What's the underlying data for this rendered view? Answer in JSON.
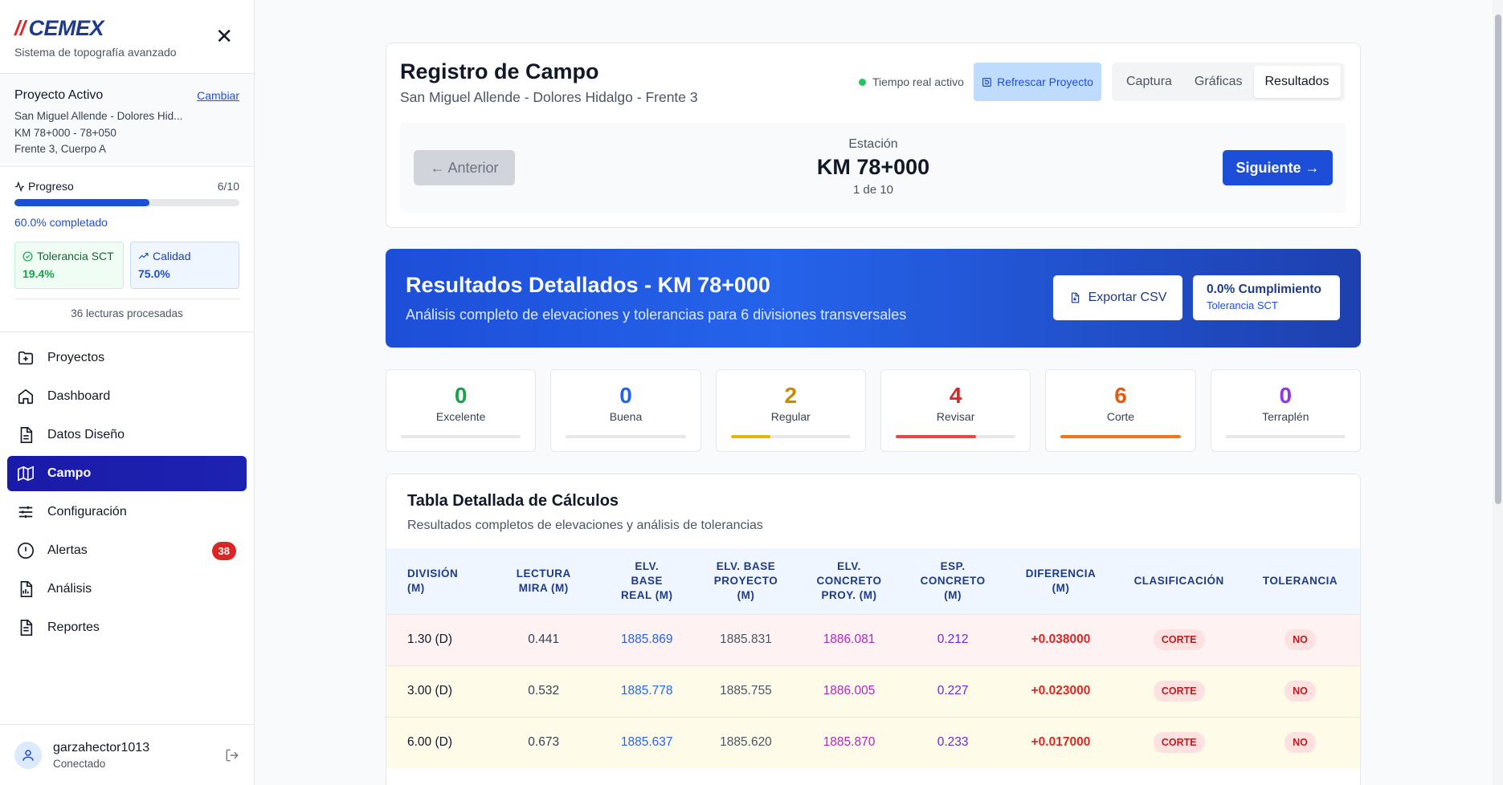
{
  "brand": {
    "logo_text": "CEMEX",
    "subtitle": "Sistema de topografía avanzado"
  },
  "project": {
    "label": "Proyecto Activo",
    "change_label": "Cambiar",
    "name": "San Miguel Allende - Dolores Hid...",
    "range": "KM 78+000 - 78+050",
    "section": "Frente 3, Cuerpo A"
  },
  "progress": {
    "label": "Progreso",
    "count": "6/10",
    "fraction": 0.6,
    "completed_text": "60.0% completado",
    "tolerance_label": "Tolerancia SCT",
    "tolerance_value": "19.4%",
    "quality_label": "Calidad",
    "quality_value": "75.0%",
    "readings_text": "36 lecturas procesadas"
  },
  "nav": {
    "items": [
      {
        "label": "Proyectos",
        "icon": "folder-plus-icon"
      },
      {
        "label": "Dashboard",
        "icon": "home-icon"
      },
      {
        "label": "Datos Diseño",
        "icon": "document-icon"
      },
      {
        "label": "Campo",
        "icon": "map-icon",
        "active": true
      },
      {
        "label": "Configuración",
        "icon": "sliders-icon"
      },
      {
        "label": "Alertas",
        "icon": "alert-circle-icon",
        "badge": "38"
      },
      {
        "label": "Análisis",
        "icon": "file-chart-icon"
      },
      {
        "label": "Reportes",
        "icon": "file-text-icon"
      }
    ]
  },
  "user": {
    "name": "garzahector1013",
    "status": "Conectado"
  },
  "header": {
    "title": "Registro de Campo",
    "subtitle": "San Miguel Allende - Dolores Hidalgo - Frente 3",
    "live_text": "Tiempo real activo",
    "refresh_label": "Refrescar Proyecto",
    "tabs": [
      "Captura",
      "Gráficas",
      "Resultados"
    ],
    "active_tab": "Resultados"
  },
  "station": {
    "prev_label": "← Anterior",
    "next_label": "Siguiente →",
    "label": "Estación",
    "km": "KM 78+000",
    "count": "1 de 10"
  },
  "banner": {
    "title": "Resultados Detallados - KM 78+000",
    "description": "Análisis completo de elevaciones y tolerancias para 6 divisiones transversales",
    "export_label": "Exportar CSV",
    "compliance_value": "0.0% Cumplimiento",
    "compliance_label": "Tolerancia SCT"
  },
  "stats": [
    {
      "value": "0",
      "label": "Excelente",
      "color": "#16a34a",
      "fraction": 0
    },
    {
      "value": "0",
      "label": "Buena",
      "color": "#2563eb",
      "fraction": 0
    },
    {
      "value": "2",
      "label": "Regular",
      "color": "#ca8a04",
      "bar_color": "#eab308",
      "fraction": 0.33
    },
    {
      "value": "4",
      "label": "Revisar",
      "color": "#dc2626",
      "bar_color": "#ef4444",
      "fraction": 0.67
    },
    {
      "value": "6",
      "label": "Corte",
      "color": "#ea580c",
      "bar_color": "#f97316",
      "fraction": 1.0
    },
    {
      "value": "0",
      "label": "Terraplén",
      "color": "#9333ea",
      "fraction": 0
    }
  ],
  "table": {
    "title": "Tabla Detallada de Cálculos",
    "subtitle": "Resultados completos de elevaciones y análisis de tolerancias",
    "headers": [
      [
        "División",
        "(m)"
      ],
      [
        "Lectura",
        "Mira (m)"
      ],
      [
        "Elv.",
        "Base",
        "Real (m)"
      ],
      [
        "Elv. Base",
        "Proyecto",
        "(m)"
      ],
      [
        "Elv.",
        "Concreto",
        "Proy. (m)"
      ],
      [
        "Esp.",
        "Concreto",
        "(m)"
      ],
      [
        "Diferencia",
        "(m)"
      ],
      [
        "Clasificación"
      ],
      [
        "Tolerancia"
      ]
    ],
    "rows": [
      {
        "tone": "red",
        "cells": [
          "1.30 (D)",
          "0.441",
          "1885.869",
          "1885.831",
          "1886.081",
          "0.212",
          "+0.038000",
          "CORTE",
          "NO"
        ]
      },
      {
        "tone": "yellow",
        "cells": [
          "3.00 (D)",
          "0.532",
          "1885.778",
          "1885.755",
          "1886.005",
          "0.227",
          "+0.023000",
          "CORTE",
          "NO"
        ]
      },
      {
        "tone": "yellow",
        "cells": [
          "6.00 (D)",
          "0.673",
          "1885.637",
          "1885.620",
          "1885.870",
          "0.233",
          "+0.017000",
          "CORTE",
          "NO"
        ]
      }
    ]
  }
}
